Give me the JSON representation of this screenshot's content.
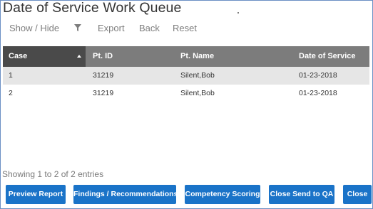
{
  "page": {
    "title": "Date of Service Work Queue"
  },
  "toolbar": {
    "show_hide": "Show / Hide",
    "filter_icon": "filter-icon",
    "export": "Export",
    "back": "Back",
    "reset": "Reset"
  },
  "table": {
    "columns": [
      "Case",
      "Pt. ID",
      "Pt. Name",
      "Date of Service"
    ],
    "sorted_column": "Case",
    "sort_direction": "ascending",
    "rows": [
      [
        "1",
        "31219",
        "Silent,Bob",
        "01-23-2018"
      ],
      [
        "2",
        "31219",
        "Silent,Bob",
        "01-23-2018"
      ]
    ]
  },
  "info": "Showing 1 to 2 of 2 entries",
  "buttons": {
    "preview": "Preview Report",
    "findings": "Findings / Recommendations",
    "competency": "Competency Scoring",
    "close_send": "Close Send to QA",
    "close": "Close"
  },
  "colors": {
    "primary_button": "#1a73c8",
    "header_bg": "#7c7c7c",
    "sorted_header_bg": "#4a4a4a",
    "frame_border": "#6b8fc4"
  }
}
